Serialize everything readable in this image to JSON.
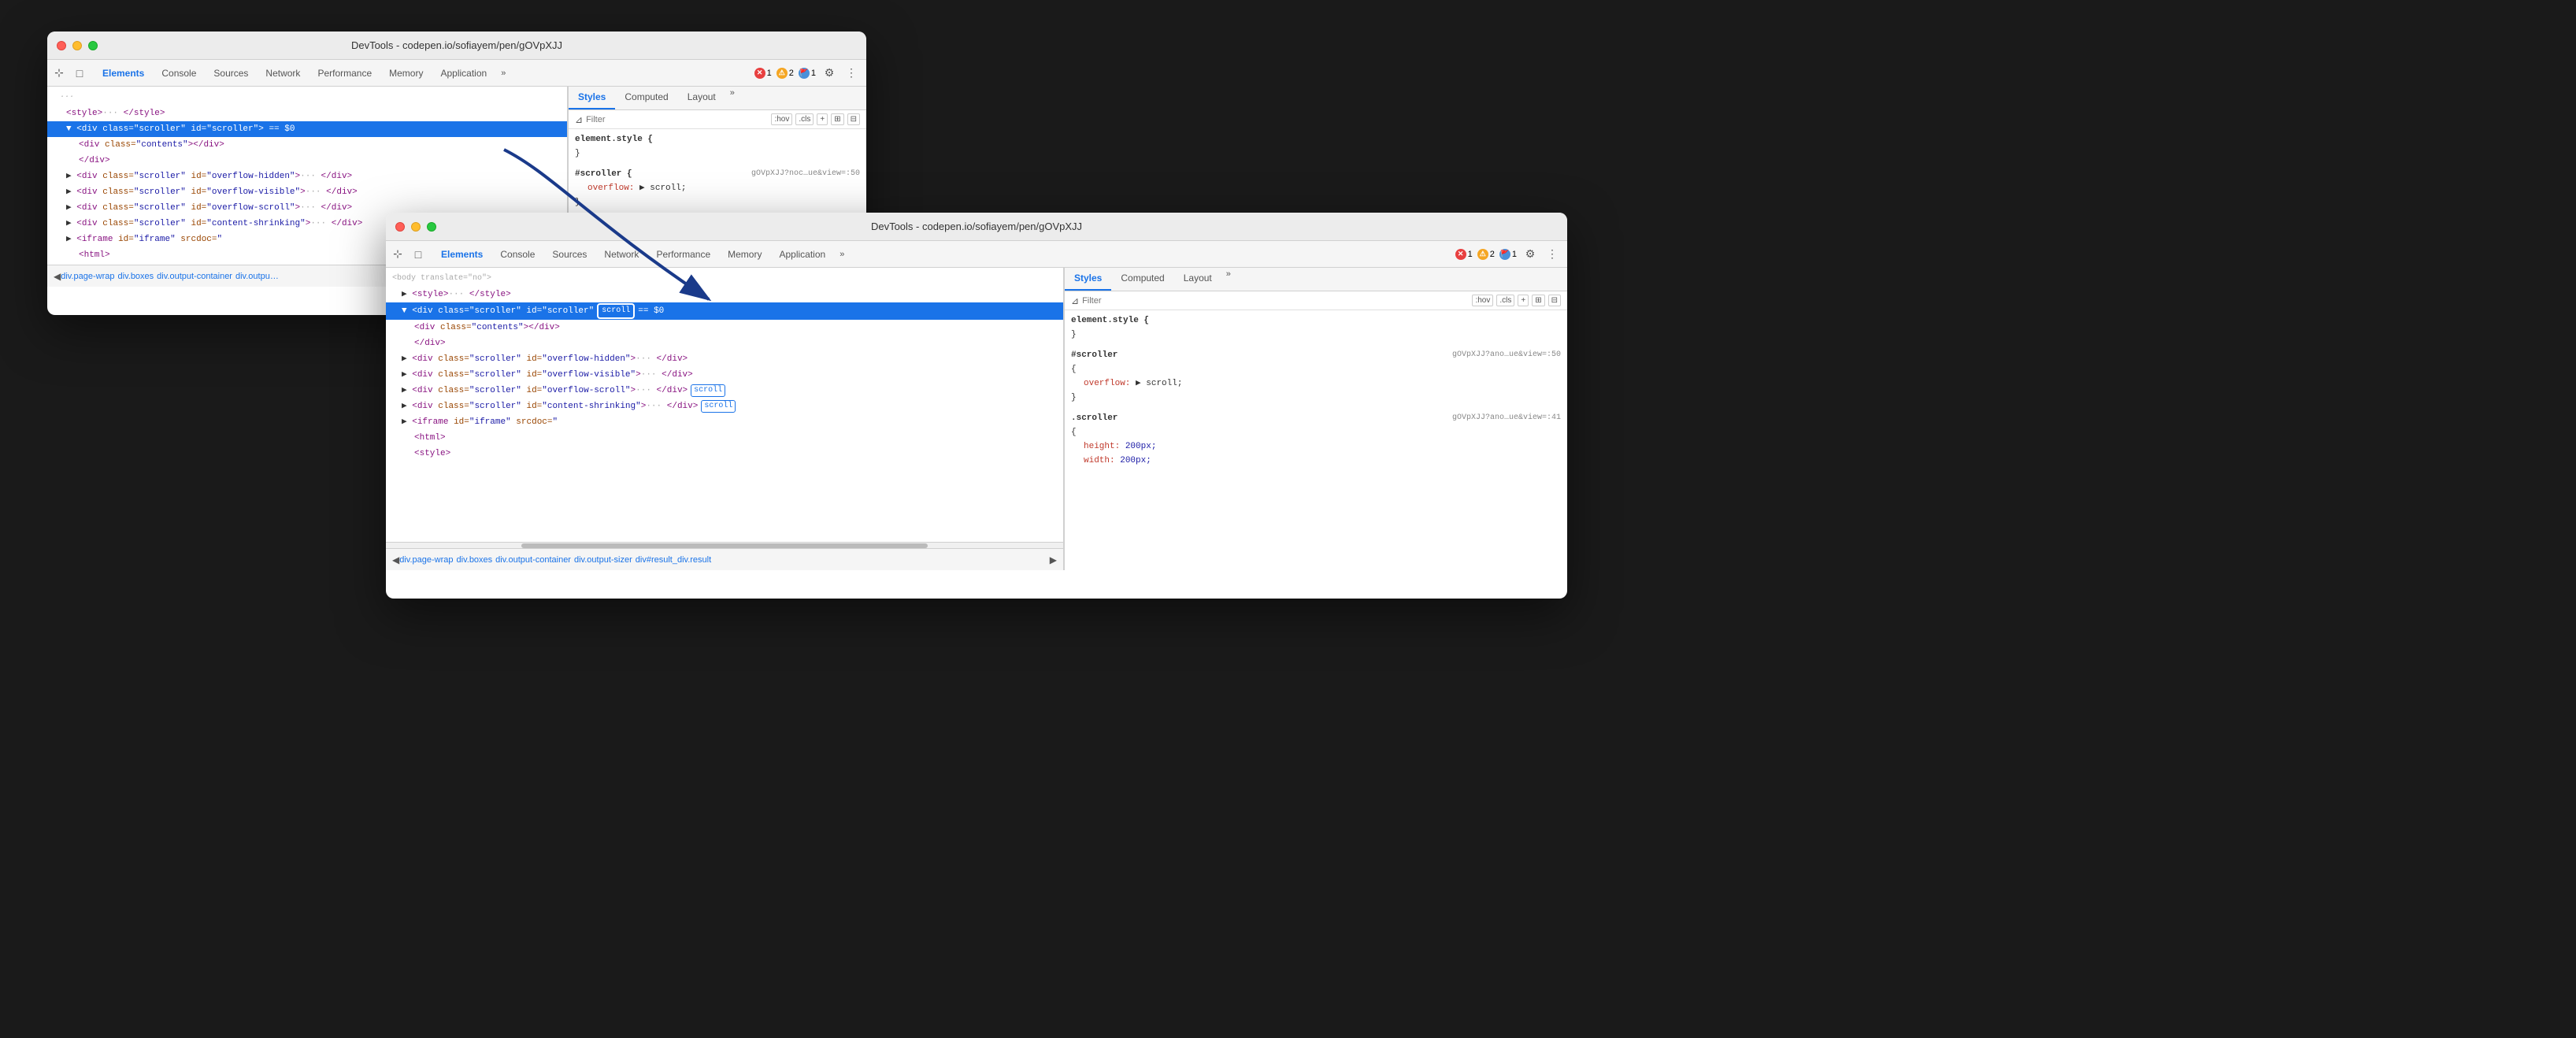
{
  "window1": {
    "title": "DevTools - codepen.io/sofiayem/pen/gOVpXJJ",
    "tabs": [
      "Elements",
      "Console",
      "Sources",
      "Network",
      "Performance",
      "Memory",
      "Application"
    ],
    "active_tab": "Elements",
    "badges": {
      "errors": "1",
      "warnings": "2",
      "info": "1"
    },
    "styles_tabs": [
      "Styles",
      "Computed",
      "Layout"
    ],
    "active_styles_tab": "Styles",
    "filter_placeholder": "Filter",
    "filter_hov": ":hov",
    "filter_cls": ".cls",
    "elements": [
      {
        "indent": 1,
        "content": "<style>··· </style>",
        "selected": false,
        "dots": "···"
      },
      {
        "indent": 1,
        "content": "<div class=\"scroller\" id=\"scroller\"> == $0",
        "selected": true
      },
      {
        "indent": 2,
        "content": "<div class=\"contents\"></div>"
      },
      {
        "indent": 2,
        "content": "</div>"
      },
      {
        "indent": 1,
        "content": "<div class=\"scroller\" id=\"overflow-hidden\">··· </div>"
      },
      {
        "indent": 1,
        "content": "<div class=\"scroller\" id=\"overflow-visible\">··· </div>"
      },
      {
        "indent": 1,
        "content": "<div class=\"scroller\" id=\"overflow-scroll\">··· </div>"
      },
      {
        "indent": 1,
        "content": "<div class=\"scroller\" id=\"content-shrinking\">··· </div>"
      },
      {
        "indent": 1,
        "content": "<iframe id=\"iframe\" srcdoc=\""
      },
      {
        "indent": 2,
        "content": "<html>"
      }
    ],
    "css_rules": [
      {
        "selector": "element.style {",
        "properties": [],
        "close": "}"
      },
      {
        "selector": "#scroller {",
        "url": "gOVpXJJ?noc…ue&view=:50",
        "properties": [
          {
            "name": "overflow:",
            "value": "▶ scroll;"
          }
        ],
        "close": "}"
      }
    ],
    "breadcrumbs": [
      "div.page-wrap",
      "div.boxes",
      "div.output-container",
      "div.outpu…"
    ]
  },
  "window2": {
    "title": "DevTools - codepen.io/sofiayem/pen/gOVpXJJ",
    "tabs": [
      "Elements",
      "Console",
      "Sources",
      "Network",
      "Performance",
      "Memory",
      "Application"
    ],
    "active_tab": "Elements",
    "badges": {
      "errors": "1",
      "warnings": "2",
      "info": "1"
    },
    "styles_tabs": [
      "Styles",
      "Computed",
      "Layout"
    ],
    "active_styles_tab": "Styles",
    "filter_placeholder": "Filter",
    "filter_hov": ":hov",
    "filter_cls": ".cls",
    "elements": [
      {
        "indent": 1,
        "content": "<body translate=\"no\">",
        "selected": false
      },
      {
        "indent": 2,
        "content": "▶ <style>··· </style>"
      },
      {
        "indent": 2,
        "content": "▼ <div class=\"scroller\" id=\"scroller\"",
        "scroll_badge": "scroll",
        "eq_sign": "== $0"
      },
      {
        "indent": 3,
        "content": "<div class=\"contents\"></div>"
      },
      {
        "indent": 3,
        "content": "</div>"
      },
      {
        "indent": 2,
        "content": "▶ <div class=\"scroller\" id=\"overflow-hidden\">··· </div>"
      },
      {
        "indent": 2,
        "content": "▶ <div class=\"scroller\" id=\"overflow-visible\">··· </div>"
      },
      {
        "indent": 2,
        "content": "▶ <div class=\"scroller\" id=\"overflow-scroll\">··· </div>",
        "scroll_badge2": "scroll"
      },
      {
        "indent": 2,
        "content": "▶ <div class=\"scroller\" id=\"content-shrinking\">···</div>",
        "scroll_badge3": "scroll"
      },
      {
        "indent": 2,
        "content": "▶ <iframe id=\"iframe\" srcdoc=\""
      },
      {
        "indent": 3,
        "content": "<html>"
      },
      {
        "indent": 3,
        "content": "<style>"
      }
    ],
    "css_rules": [
      {
        "selector": "element.style {",
        "properties": [],
        "close": "}"
      },
      {
        "selector": "#scroller",
        "url": "gOVpXJJ?ano…ue&view=:50",
        "properties": [
          {
            "name": "overflow:",
            "value": "▶ scroll;"
          }
        ],
        "close": "}"
      },
      {
        "selector": ".scroller",
        "url": "gOVpXJJ?ano…ue&view=:41",
        "properties": [
          {
            "name": "height:",
            "value": "200px;"
          },
          {
            "name": "width:",
            "value": "200px;"
          }
        ],
        "close": ""
      }
    ],
    "breadcrumbs": [
      "div.page-wrap",
      "div.boxes",
      "div.output-container",
      "div.output-sizer",
      "div#result_div.result"
    ]
  },
  "icons": {
    "cursor": "⊹",
    "inspect": "□",
    "more": "»",
    "settings": "⚙",
    "three_dots": "⋮",
    "filter": "⊿",
    "plus": "+",
    "toggle1": "⊞",
    "toggle2": "⊟",
    "nav_left": "◀",
    "nav_right": "▶"
  }
}
